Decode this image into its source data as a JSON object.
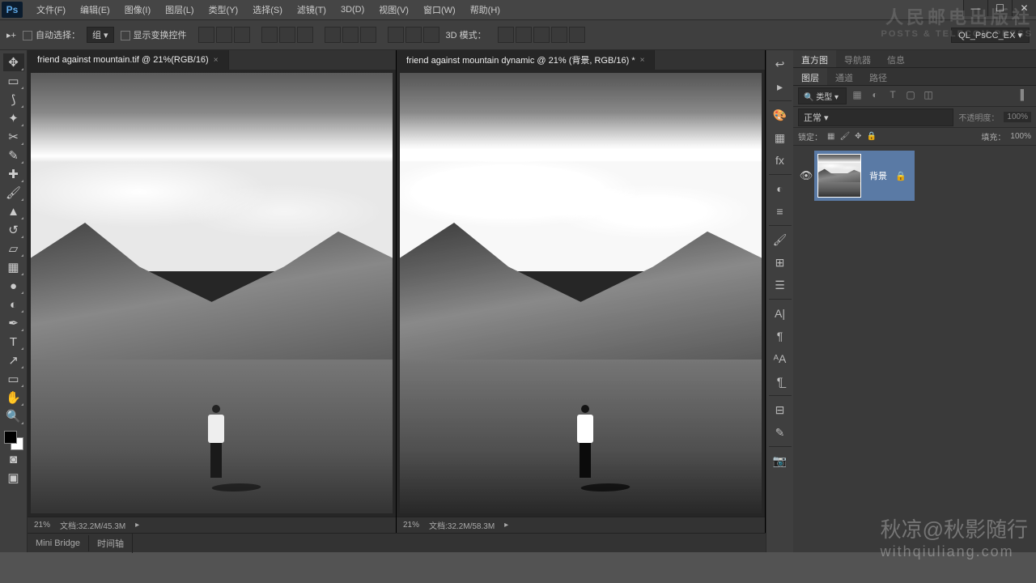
{
  "menu": {
    "items": [
      "文件(F)",
      "编辑(E)",
      "图像(I)",
      "图层(L)",
      "类型(Y)",
      "选择(S)",
      "滤镜(T)",
      "3D(D)",
      "视图(V)",
      "窗口(W)",
      "帮助(H)"
    ]
  },
  "winctrl": {
    "min": "—",
    "max": "☐",
    "close": "✕"
  },
  "options": {
    "auto_select": "自动选择：",
    "group": "组",
    "show_transform": "显示变换控件",
    "mode_3d": "3D 模式：",
    "workspace": "QL_PsCC_EX"
  },
  "tabs": [
    {
      "title": "friend against mountain.tif @ 21%(RGB/16)",
      "active": true
    },
    {
      "title": "friend against mountain dynamic @ 21% (背景, RGB/16) *",
      "active": false
    }
  ],
  "status": [
    {
      "zoom": "21%",
      "doc": "文档:32.2M/45.3M"
    },
    {
      "zoom": "21%",
      "doc": "文档:32.2M/58.3M"
    }
  ],
  "panel_tabs_top": {
    "histogram": "直方图",
    "navigator": "导航器",
    "info": "信息"
  },
  "panel_tabs_layers": {
    "layers": "图层",
    "channels": "通道",
    "paths": "路径"
  },
  "layer_filter": {
    "kind": "类型"
  },
  "blend": {
    "mode": "正常",
    "opacity_label": "不透明度：",
    "opacity_val": "100%",
    "fill_label": "填充：",
    "fill_val": "100%",
    "lock_label": "锁定："
  },
  "layer": {
    "name": "背景"
  },
  "bottom_tabs": {
    "mini_bridge": "Mini Bridge",
    "timeline": "时间轴"
  },
  "watermark": {
    "line1": "人民邮电出版社",
    "line2": "POSTS & TELECOM PRESS",
    "line3": "秋凉@秋影随行",
    "line4": "withqiuliang.com"
  }
}
